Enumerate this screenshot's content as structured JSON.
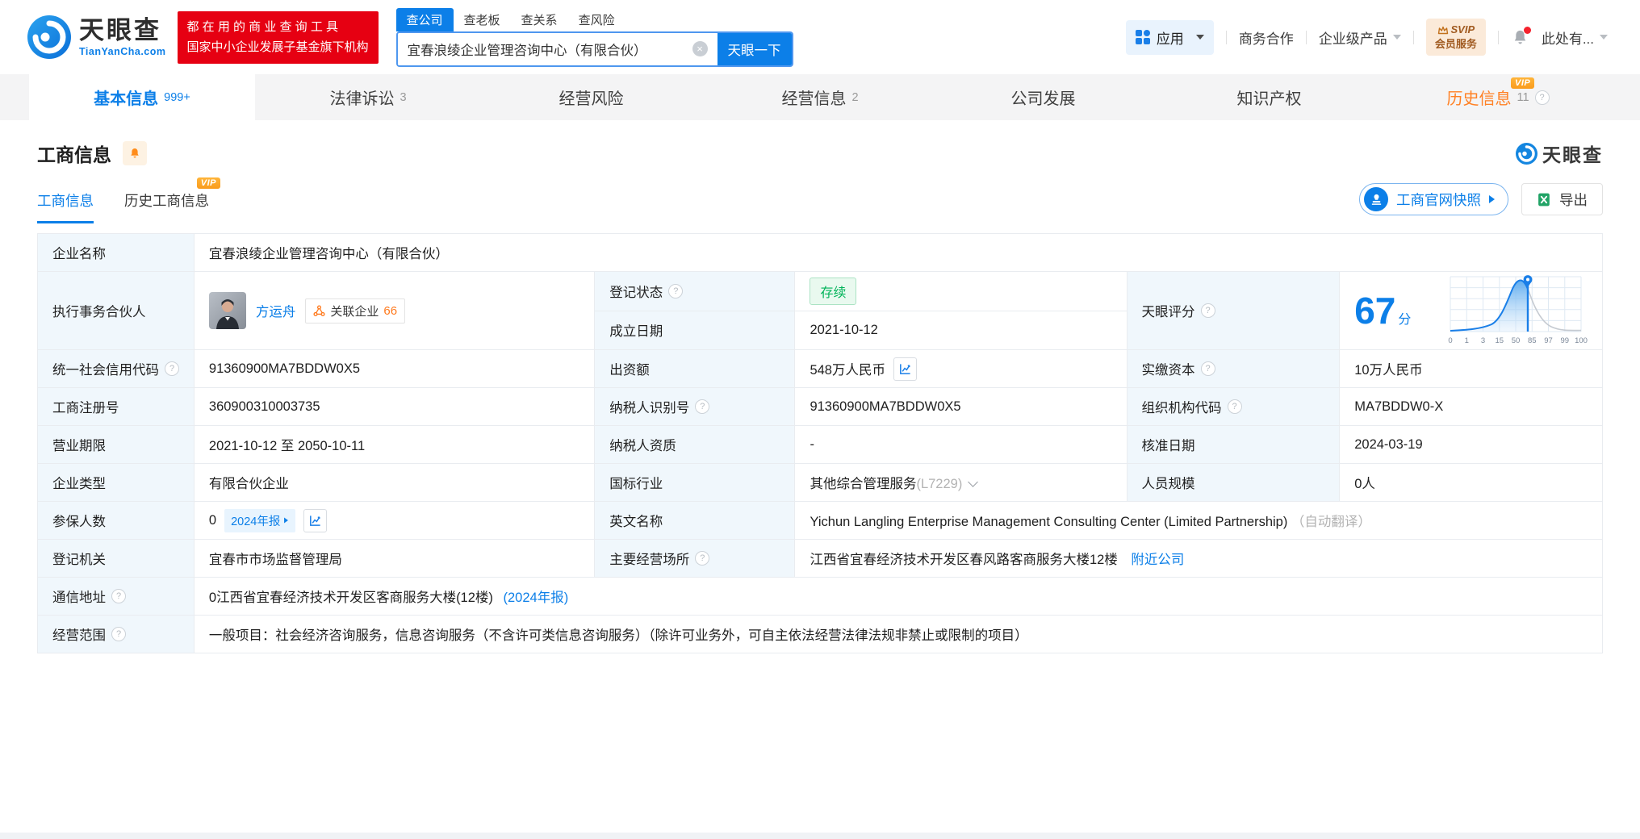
{
  "accent_color": "#0c7fe8",
  "brand": {
    "logo_text": "天眼查",
    "logo_domain": "TianYanCha.com",
    "banner_line1": "都 在 用 的 商 业 查 询 工 具",
    "banner_line2": "国家中小企业发展子基金旗下机构"
  },
  "search": {
    "tab_company": "查公司",
    "tab_boss": "查老板",
    "tab_relation": "查关系",
    "tab_risk": "查风险",
    "input_value": "宜春浪绫企业管理咨询中心（有限合伙）",
    "submit_label": "天眼一下"
  },
  "header_right": {
    "apps_label": "应用",
    "cooperation_label": "商务合作",
    "enterprise_label": "企业级产品",
    "svip_line1": "SVIP",
    "svip_line2": "会员服务",
    "account_label": "此处有..."
  },
  "nav_tabs": [
    {
      "label": "基本信息",
      "count": "999+"
    },
    {
      "label": "法律诉讼",
      "count": "3"
    },
    {
      "label": "经营风险",
      "count": ""
    },
    {
      "label": "经营信息",
      "count": "2"
    },
    {
      "label": "公司发展",
      "count": ""
    },
    {
      "label": "知识产权",
      "count": ""
    },
    {
      "label": "历史信息",
      "count": "11",
      "vip": "VIP"
    }
  ],
  "section": {
    "title": "工商信息",
    "subtab_current": "工商信息",
    "subtab_history": "历史工商信息",
    "subtab_history_vip": "VIP",
    "snapshot_label": "工商官网快照",
    "export_label": "导出",
    "brand_small": "天眼查"
  },
  "fields": {
    "company_name_label": "企业名称",
    "company_name_value": "宜春浪绫企业管理咨询中心（有限合伙）",
    "partner_label": "执行事务合伙人",
    "partner_name": "方运舟",
    "partner_related_label": "关联企业",
    "partner_related_count": "66",
    "reg_status_label": "登记状态",
    "reg_status_value": "存续",
    "establish_date_label": "成立日期",
    "establish_date_value": "2021-10-12",
    "score_label": "天眼评分",
    "score_value": "67",
    "score_unit": "分",
    "credit_code_label": "统一社会信用代码",
    "credit_code_value": "91360900MA7BDDW0X5",
    "capital_label": "出资额",
    "capital_value": "548万人民币",
    "paid_capital_label": "实缴资本",
    "paid_capital_value": "10万人民币",
    "reg_number_label": "工商注册号",
    "reg_number_value": "360900310003735",
    "taxpayer_id_label": "纳税人识别号",
    "taxpayer_id_value": "91360900MA7BDDW0X5",
    "org_code_label": "组织机构代码",
    "org_code_value": "MA7BDDW0-X",
    "business_term_label": "营业期限",
    "business_term_value": "2021-10-12 至 2050-10-11",
    "taxpayer_quality_label": "纳税人资质",
    "taxpayer_quality_value": "-",
    "approval_date_label": "核准日期",
    "approval_date_value": "2024-03-19",
    "company_type_label": "企业类型",
    "company_type_value": "有限合伙企业",
    "industry_label": "国标行业",
    "industry_value": "其他综合管理服务",
    "industry_code": "(L7229)",
    "staff_size_label": "人员规模",
    "staff_size_value": "0人",
    "insured_label": "参保人数",
    "insured_value": "0",
    "insured_report_badge": "2024年报",
    "english_name_label": "英文名称",
    "english_name_value": "Yichun Langling Enterprise Management Consulting Center (Limited Partnership)",
    "english_name_note": "（自动翻译）",
    "reg_authority_label": "登记机关",
    "reg_authority_value": "宜春市市场监督管理局",
    "business_site_label": "主要经营场所",
    "business_site_value": "江西省宜春经济技术开发区春风路客商服务大楼12楼",
    "nearby_link": "附近公司",
    "postal_address_label": "通信地址",
    "postal_address_value": "0江西省宜春经济技术开发区客商服务大楼(12楼)",
    "postal_address_report_link": "(2024年报)",
    "business_scope_label": "经营范围",
    "business_scope_value": "一般项目：社会经济咨询服务，信息咨询服务（不含许可类信息咨询服务）（除许可业务外，可自主依法经营法律法规非禁止或限制的项目）"
  },
  "chart_data": {
    "type": "area",
    "title": "天眼评分 score distribution curve",
    "score": 67,
    "marker_percentile": 67,
    "x_tick_labels": [
      "0",
      "1",
      "3",
      "15",
      "50",
      "85",
      "97",
      "99",
      "100"
    ],
    "legend_position": "none",
    "grid": true
  }
}
